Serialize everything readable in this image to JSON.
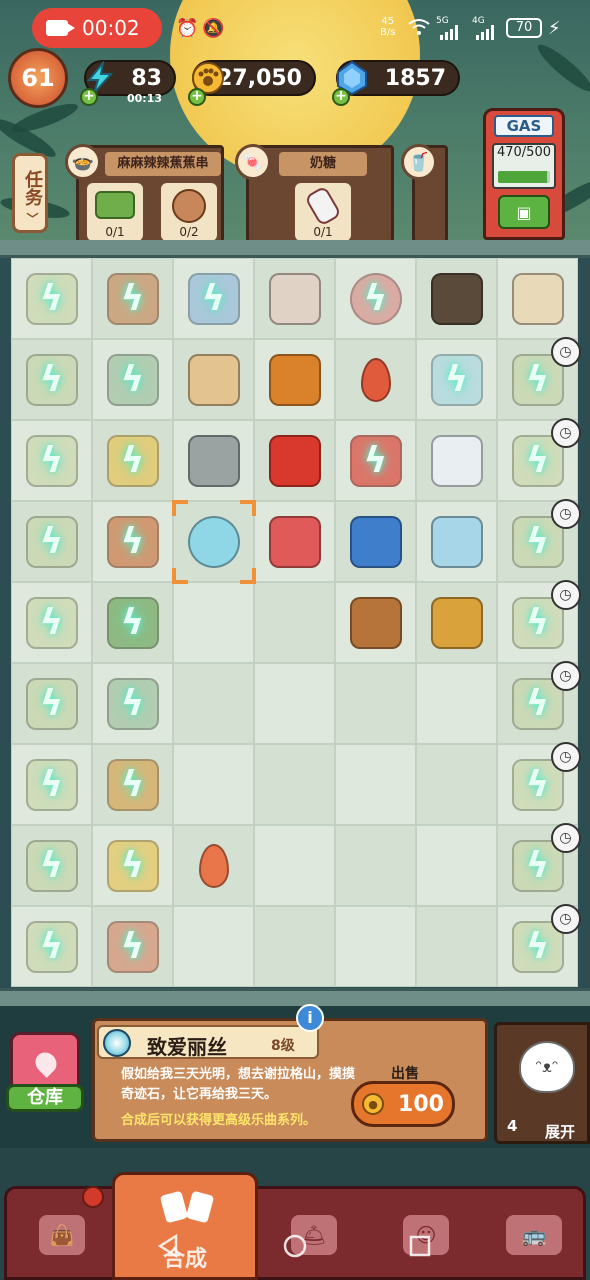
{
  "status_bar": {
    "recording_time": "00:02",
    "network_speed": "45",
    "network_unit": "B/s",
    "battery": "70",
    "signal_labels": [
      "5G",
      "4G"
    ]
  },
  "resources": {
    "level": "61",
    "energy": "83",
    "energy_timer": "00:13",
    "coins": "27,050",
    "gems": "1857"
  },
  "tasks": {
    "label": "任务"
  },
  "orders": [
    {
      "title": "麻麻辣辣蕉蕉串",
      "items": [
        {
          "count": "0/1",
          "icon": "vegetable-plate-icon"
        },
        {
          "count": "0/2",
          "icon": "meatball-icon"
        }
      ]
    },
    {
      "title": "奶糖",
      "items": [
        {
          "count": "0/1",
          "icon": "milk-candy-icon"
        }
      ]
    }
  ],
  "gas_station": {
    "label": "GAS",
    "meter": "470/500",
    "fill_fraction": 0.94
  },
  "board": {
    "rows": 9,
    "cols": 7,
    "items": [
      {
        "r": 0,
        "c": 0,
        "icon": "drone-stack-icon",
        "color": "#c9d6a8",
        "locked": true
      },
      {
        "r": 0,
        "c": 1,
        "icon": "hotpot-icon",
        "color": "#c98a5a",
        "locked": true
      },
      {
        "r": 0,
        "c": 2,
        "icon": "notebook-icon",
        "color": "#8fb7d8",
        "locked": true
      },
      {
        "r": 0,
        "c": 3,
        "icon": "spice-box-icon",
        "color": "#e0d2c4",
        "locked": false
      },
      {
        "r": 0,
        "c": 4,
        "icon": "jam-jar-icon",
        "color": "#d98a86",
        "locked": true
      },
      {
        "r": 0,
        "c": 5,
        "icon": "soy-sauce-icon",
        "color": "#5a4a3a",
        "locked": false
      },
      {
        "r": 0,
        "c": 6,
        "icon": "oven-icon",
        "color": "#e8d9b8",
        "locked": false
      },
      {
        "r": 1,
        "c": 0,
        "icon": "drone-stack-icon",
        "color": "#c9d6a8",
        "locked": true
      },
      {
        "r": 1,
        "c": 1,
        "icon": "pencil-cup-icon",
        "color": "#9bbf9b",
        "locked": true
      },
      {
        "r": 1,
        "c": 2,
        "icon": "rice-mat-icon",
        "color": "#e3c38f",
        "locked": false
      },
      {
        "r": 1,
        "c": 3,
        "icon": "moon-ornament-icon",
        "color": "#d9822b",
        "locked": false
      },
      {
        "r": 1,
        "c": 4,
        "icon": "red-triangle-icon",
        "color": "#e05a3c",
        "locked": false
      },
      {
        "r": 1,
        "c": 5,
        "icon": "crystal-block-icon",
        "color": "#a7d6e0",
        "locked": true
      },
      {
        "r": 1,
        "c": 6,
        "icon": "leaf-basket-icon",
        "color": "#c9d6a8",
        "locked": true,
        "timer": true
      },
      {
        "r": 2,
        "c": 0,
        "icon": "drone-stack-icon",
        "color": "#c9d6a8",
        "locked": true
      },
      {
        "r": 2,
        "c": 1,
        "icon": "chef-hat-icon",
        "color": "#e8c34f",
        "locked": true
      },
      {
        "r": 2,
        "c": 2,
        "icon": "clay-pot-icon",
        "color": "#9aa2a2",
        "locked": false
      },
      {
        "r": 2,
        "c": 3,
        "icon": "double-happiness-icon",
        "color": "#d9382c",
        "locked": false
      },
      {
        "r": 2,
        "c": 4,
        "icon": "paw-tile-icon",
        "color": "#d9382c",
        "locked": true
      },
      {
        "r": 2,
        "c": 5,
        "icon": "bottles-icon",
        "color": "#e8eef2",
        "locked": false
      },
      {
        "r": 2,
        "c": 6,
        "icon": "leaf-basket-icon",
        "color": "#c9d6a8",
        "locked": true,
        "timer": true
      },
      {
        "r": 3,
        "c": 0,
        "icon": "drone-stack-icon",
        "color": "#c9d6a8",
        "locked": true
      },
      {
        "r": 3,
        "c": 1,
        "icon": "diving-helmet-icon",
        "color": "#c9703a",
        "locked": true
      },
      {
        "r": 3,
        "c": 2,
        "icon": "snow-globe-icon",
        "color": "#8fd7e6",
        "locked": false,
        "selected": true
      },
      {
        "r": 3,
        "c": 3,
        "icon": "rose-bouquet-icon",
        "color": "#e05a5a",
        "locked": false
      },
      {
        "r": 3,
        "c": 4,
        "icon": "wizard-hat-icon",
        "color": "#3f7ecb",
        "locked": false
      },
      {
        "r": 3,
        "c": 5,
        "icon": "aquarium-icon",
        "color": "#a7d6e8",
        "locked": false
      },
      {
        "r": 3,
        "c": 6,
        "icon": "leaf-basket-icon",
        "color": "#c9d6a8",
        "locked": true,
        "timer": true
      },
      {
        "r": 4,
        "c": 0,
        "icon": "drone-stack-icon",
        "color": "#c9d6a8",
        "locked": true
      },
      {
        "r": 4,
        "c": 1,
        "icon": "flower-tree-icon",
        "color": "#6aa55a",
        "locked": true
      },
      {
        "r": 4,
        "c": 4,
        "icon": "dreamcatcher-icon",
        "color": "#b7743a",
        "locked": false
      },
      {
        "r": 4,
        "c": 5,
        "icon": "golden-octopus-icon",
        "color": "#d9a23a",
        "locked": false
      },
      {
        "r": 4,
        "c": 6,
        "icon": "leaf-basket-icon",
        "color": "#c9d6a8",
        "locked": true,
        "timer": true
      },
      {
        "r": 5,
        "c": 0,
        "icon": "drone-stack-icon",
        "color": "#c9d6a8",
        "locked": true
      },
      {
        "r": 5,
        "c": 1,
        "icon": "sewing-machine-icon",
        "color": "#9bbf9b",
        "locked": true
      },
      {
        "r": 5,
        "c": 6,
        "icon": "leaf-basket-icon",
        "color": "#c9d6a8",
        "locked": true,
        "timer": true
      },
      {
        "r": 6,
        "c": 0,
        "icon": "drone-stack-icon",
        "color": "#c9d6a8",
        "locked": true
      },
      {
        "r": 6,
        "c": 1,
        "icon": "backpack-icon",
        "color": "#d9a24a",
        "locked": true
      },
      {
        "r": 6,
        "c": 6,
        "icon": "leaf-basket-icon",
        "color": "#c9d6a8",
        "locked": true,
        "timer": true
      },
      {
        "r": 7,
        "c": 0,
        "icon": "drone-stack-icon",
        "color": "#c9d6a8",
        "locked": true
      },
      {
        "r": 7,
        "c": 1,
        "icon": "vending-machine-icon",
        "color": "#e8c34f",
        "locked": true
      },
      {
        "r": 7,
        "c": 2,
        "icon": "orange-crystal-icon",
        "color": "#e8764a",
        "locked": false
      },
      {
        "r": 7,
        "c": 6,
        "icon": "leaf-basket-icon",
        "color": "#c9d6a8",
        "locked": true,
        "timer": true
      },
      {
        "r": 8,
        "c": 0,
        "icon": "drone-stack-icon",
        "color": "#c9d6a8",
        "locked": true
      },
      {
        "r": 8,
        "c": 1,
        "icon": "toolbox-icon",
        "color": "#d98a6a",
        "locked": true
      },
      {
        "r": 8,
        "c": 6,
        "icon": "leaf-basket-icon",
        "color": "#c9d6a8",
        "locked": true,
        "timer": true
      }
    ]
  },
  "selected_item": {
    "name": "致爱丽丝",
    "level": "8级",
    "description": "假如给我三天光明，想去谢拉格山，摸摸奇迹石，让它再给我三天。",
    "hint": "合成后可以获得更高级乐曲系列。",
    "sell_label": "出售",
    "sell_price": "100"
  },
  "warehouse": {
    "label": "仓库"
  },
  "expand": {
    "count": "4",
    "label": "展开"
  },
  "nav": {
    "active_label": "合成"
  }
}
